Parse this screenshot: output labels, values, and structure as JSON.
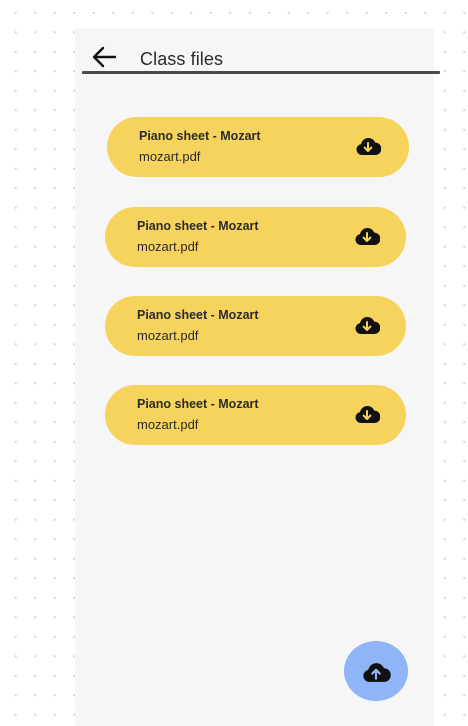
{
  "header": {
    "title": "Class files",
    "back_icon": "arrow-left-icon"
  },
  "files": [
    {
      "name": "Piano sheet - Mozart",
      "filename": "mozart.pdf",
      "icon": "cloud-download-icon"
    },
    {
      "name": "Piano sheet - Mozart",
      "filename": "mozart.pdf",
      "icon": "cloud-download-icon"
    },
    {
      "name": "Piano sheet - Mozart",
      "filename": "mozart.pdf",
      "icon": "cloud-download-icon"
    },
    {
      "name": "Piano sheet - Mozart",
      "filename": "mozart.pdf",
      "icon": "cloud-download-icon"
    }
  ],
  "fab": {
    "icon": "cloud-upload-icon"
  },
  "colors": {
    "card": "#f6d35c",
    "fab": "#8fb4f7",
    "panel": "#f6f6f6"
  }
}
